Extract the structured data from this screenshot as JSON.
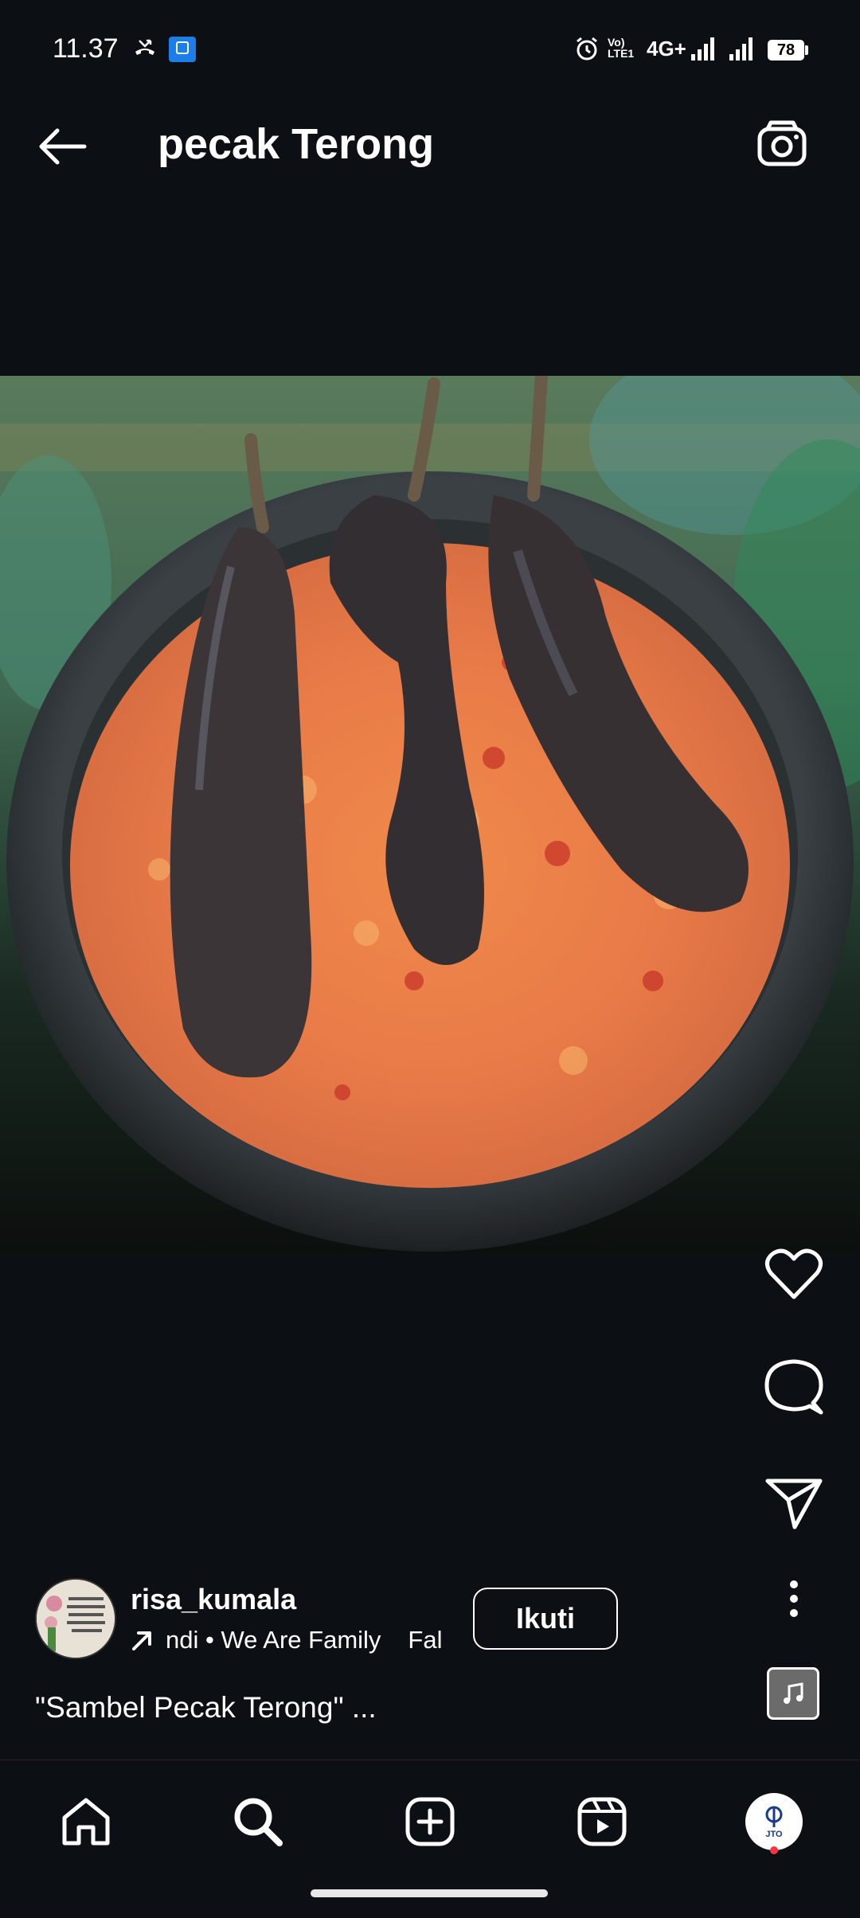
{
  "status_bar": {
    "time": "11.37",
    "network": "4G+",
    "volte": "Vo) LTE1",
    "battery": "78"
  },
  "header": {
    "title": "pecak Terong",
    "back_icon": "arrow-left-icon",
    "camera_icon": "camera-icon"
  },
  "media": {
    "icons": [
      "heart-icon",
      "comment-icon",
      "share-icon",
      "more-icon"
    ]
  },
  "author": {
    "username": "risa_kumala",
    "music_text": "ndi • We Are Family",
    "music_tail": "Fal",
    "follow_label": "Ikuti"
  },
  "caption": "\"Sambel Pecak Terong\" ...",
  "nav": {
    "items": [
      "home-icon",
      "search-icon",
      "create-icon",
      "reels-icon",
      "profile-icon"
    ],
    "profile_label": "JTO"
  },
  "colors": {
    "background": "#0c1014",
    "accent_dot": "#ff3040"
  }
}
